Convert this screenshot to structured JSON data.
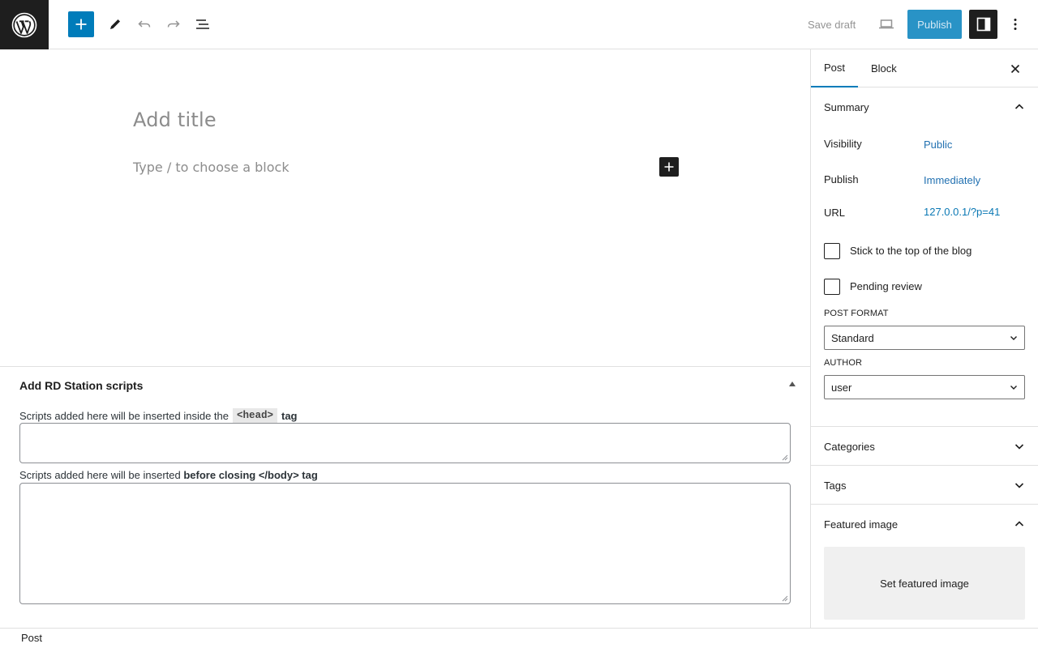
{
  "toolbar": {
    "logo_icon": "wordpress-logo-icon",
    "inserter_icon": "plus-icon",
    "edit_icon": "pencil-icon",
    "undo_icon": "undo-icon",
    "redo_icon": "redo-icon",
    "list_view_icon": "list-view-icon",
    "save_draft_label": "Save draft",
    "preview_icon": "laptop-icon",
    "publish_label": "Publish",
    "settings_icon": "sidebar-toggle-icon",
    "options_icon": "vertical-ellipsis-icon"
  },
  "editor": {
    "title_placeholder": "Add title",
    "block_placeholder": "Type / to choose a block"
  },
  "metabox": {
    "title": "Add RD Station scripts",
    "head_label_before": "Scripts added here will be inserted inside the",
    "head_code": "<head>",
    "head_label_after": "tag",
    "head_value": "",
    "body_label_before": "Scripts added here will be inserted",
    "body_label_bold": "before closing </body> tag",
    "body_value": ""
  },
  "footer": {
    "breadcrumb": "Post"
  },
  "sidebar": {
    "tabs": [
      {
        "label": "Post",
        "active": true
      },
      {
        "label": "Block",
        "active": false
      }
    ],
    "summary": {
      "title": "Summary",
      "visibility_label": "Visibility",
      "visibility_value": "Public",
      "publish_label": "Publish",
      "publish_value": "Immediately",
      "url_label": "URL",
      "url_value": "127.0.0.1/?p=41",
      "sticky_label": "Stick to the top of the blog",
      "sticky_checked": false,
      "pending_label": "Pending review",
      "pending_checked": false,
      "post_format_label": "POST FORMAT",
      "post_format_value": "Standard",
      "author_label": "AUTHOR",
      "author_value": "user"
    },
    "panels": {
      "categories": "Categories",
      "tags": "Tags",
      "featured_image": "Featured image",
      "set_featured_image": "Set featured image"
    }
  },
  "colors": {
    "accent": "#007cba",
    "publish_bg": "#2993c6",
    "dark": "#1e1e1e",
    "link": "#2271b1"
  }
}
